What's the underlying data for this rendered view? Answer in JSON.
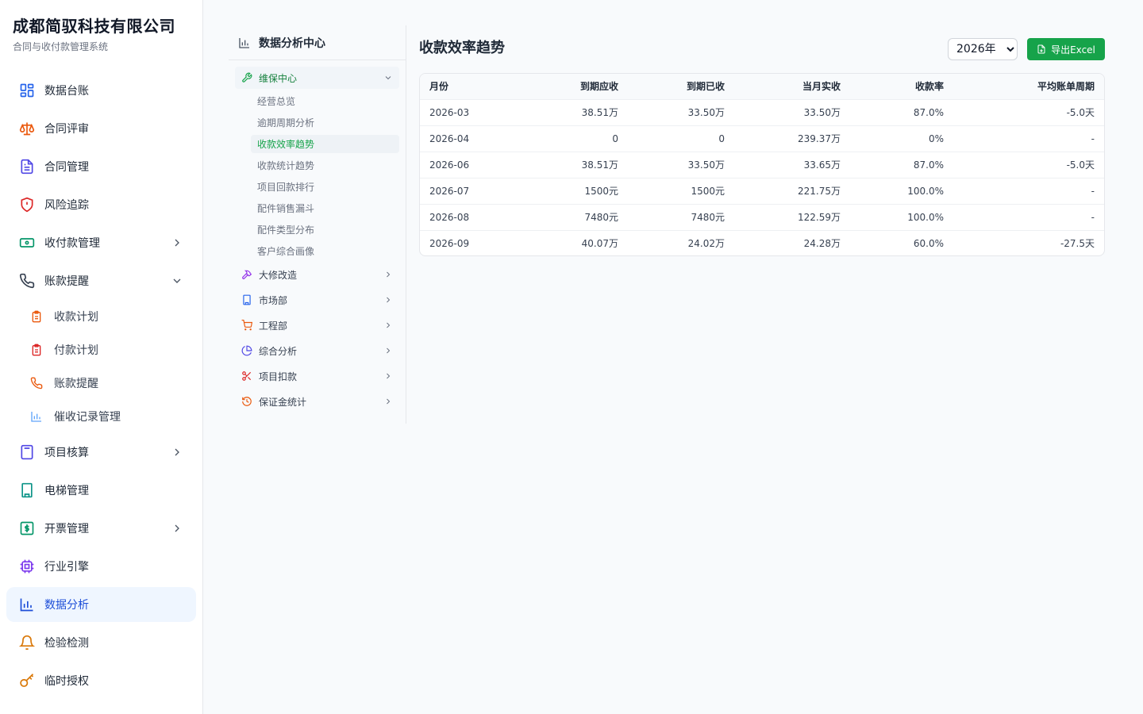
{
  "brand": {
    "title": "成都简驭科技有限公司",
    "subtitle": "合同与收付款管理系统"
  },
  "sidebar": {
    "items": [
      {
        "label": "数据台账",
        "icon": "dashboard-grid-icon"
      },
      {
        "label": "合同评审",
        "icon": "scale-icon"
      },
      {
        "label": "合同管理",
        "icon": "document-icon"
      },
      {
        "label": "风险追踪",
        "icon": "shield-alert-icon"
      },
      {
        "label": "收付款管理",
        "icon": "banknote-icon"
      },
      {
        "label": "账款提醒",
        "icon": "phone-icon",
        "expanded": true,
        "children": [
          {
            "label": "收款计划",
            "icon": "clipboard-icon"
          },
          {
            "label": "付款计划",
            "icon": "clipboard-icon"
          },
          {
            "label": "账款提醒",
            "icon": "phone-icon"
          },
          {
            "label": "催收记录管理",
            "icon": "bar-chart-icon"
          }
        ]
      },
      {
        "label": "项目核算",
        "icon": "calculator-icon"
      },
      {
        "label": "电梯管理",
        "icon": "building-icon"
      },
      {
        "label": "开票管理",
        "icon": "dollar-square-icon"
      },
      {
        "label": "行业引擎",
        "icon": "cpu-chip-icon"
      },
      {
        "label": "数据分析",
        "icon": "bar-chart-icon",
        "active": true
      },
      {
        "label": "检验检测",
        "icon": "bell-icon"
      },
      {
        "label": "临时授权",
        "icon": "key-icon"
      }
    ]
  },
  "analytics_nav": {
    "title": "数据分析中心",
    "groups": [
      {
        "label": "维保中心",
        "icon": "wrench-icon",
        "open": true,
        "children": [
          "经营总览",
          "逾期周期分析",
          "收款效率趋势",
          "收款统计趋势",
          "项目回款排行",
          "配件销售漏斗",
          "配件类型分布",
          "客户综合画像"
        ],
        "active_child": "收款效率趋势"
      },
      {
        "label": "大修改造",
        "icon": "hammer-icon"
      },
      {
        "label": "市场部",
        "icon": "building-icon"
      },
      {
        "label": "工程部",
        "icon": "cart-icon"
      },
      {
        "label": "综合分析",
        "icon": "pie-chart-icon"
      },
      {
        "label": "项目扣款",
        "icon": "scissors-icon"
      },
      {
        "label": "保证金统计",
        "icon": "history-icon"
      }
    ]
  },
  "main": {
    "title": "收款效率趋势",
    "year": "2026年",
    "year_options": [
      "2026年"
    ],
    "export_label": "导出Excel",
    "table": {
      "columns": [
        "月份",
        "到期应收",
        "到期已收",
        "当月实收",
        "收款率",
        "平均账单周期"
      ],
      "rows": [
        [
          "2026-03",
          "38.51万",
          "33.50万",
          "33.50万",
          "87.0%",
          "-5.0天"
        ],
        [
          "2026-04",
          "0",
          "0",
          "239.37万",
          "0%",
          "-"
        ],
        [
          "2026-06",
          "38.51万",
          "33.50万",
          "33.65万",
          "87.0%",
          "-5.0天"
        ],
        [
          "2026-07",
          "1500元",
          "1500元",
          "221.75万",
          "100.0%",
          "-"
        ],
        [
          "2026-08",
          "7480元",
          "7480元",
          "122.59万",
          "100.0%",
          "-"
        ],
        [
          "2026-09",
          "40.07万",
          "24.02万",
          "24.28万",
          "60.0%",
          "-27.5天"
        ]
      ]
    }
  },
  "colors": {
    "accent_blue": "#1d4ed8",
    "active_bg": "#eff6ff",
    "success_green": "#16a34a"
  }
}
